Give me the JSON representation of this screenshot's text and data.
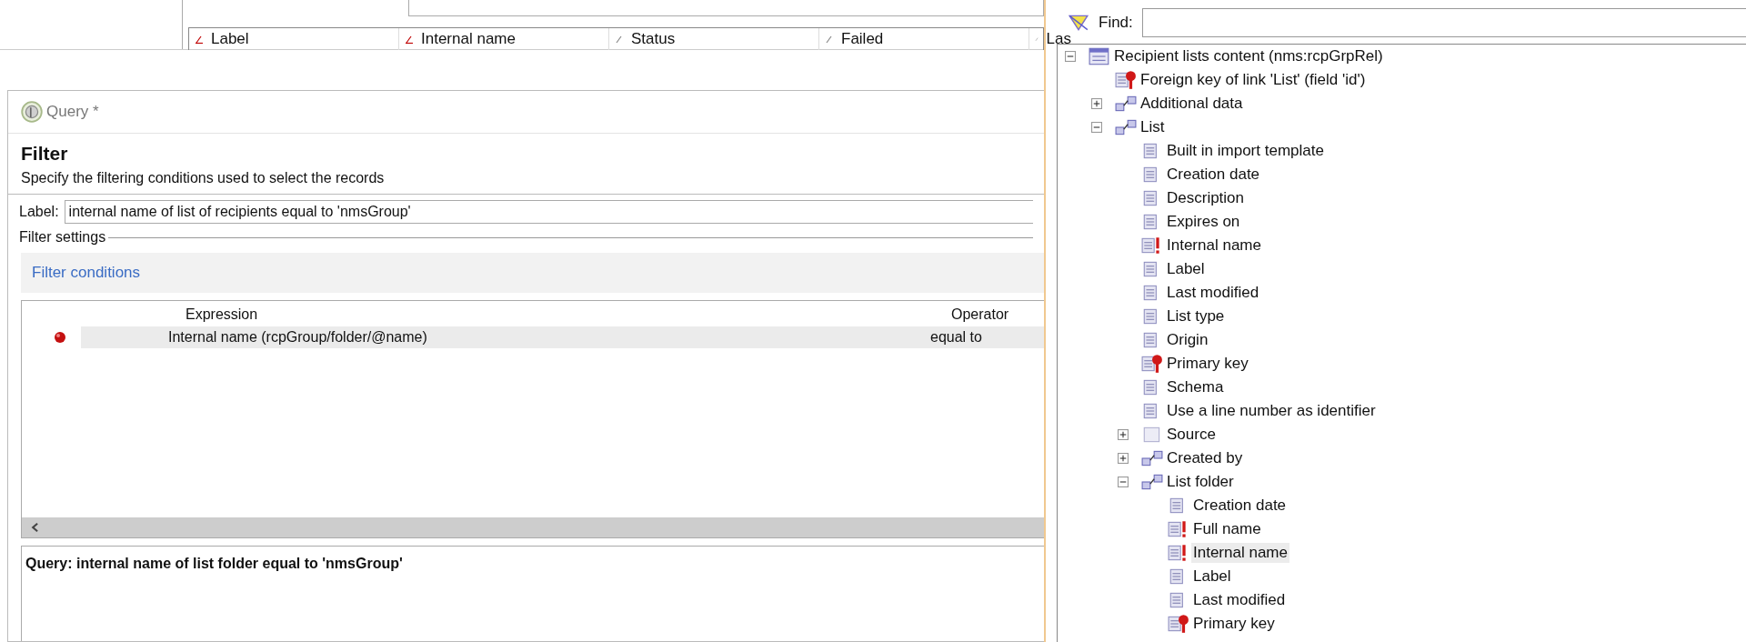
{
  "background_window": {
    "columns": [
      {
        "label": "Label",
        "sorted": true
      },
      {
        "label": "Internal name",
        "sorted": true
      },
      {
        "label": "Status",
        "sorted": false
      },
      {
        "label": "Failed",
        "sorted": false
      },
      {
        "label": "Las",
        "sorted": false
      }
    ]
  },
  "dialog": {
    "title": "Query *",
    "heading": "Filter",
    "description": "Specify the filtering conditions used to select the records",
    "label_caption": "Label:",
    "label_value": "internal name of list of recipients equal to 'nmsGroup'",
    "group_title": "Filter settings",
    "conditions_link": "Filter conditions",
    "table": {
      "columns": [
        "Expression",
        "Operator"
      ],
      "rows": [
        {
          "expression": "Internal name (rcpGroup/folder/@name)",
          "operator": "equal to",
          "selected": true
        }
      ]
    },
    "summary": "Query: internal name of list folder equal to 'nmsGroup'"
  },
  "schema_panel": {
    "find_label": "Find:",
    "tree": [
      {
        "label": "Recipient lists content (nms:rcpGrpRel)",
        "kind": "table",
        "expanded": true,
        "selected": false,
        "children": [
          {
            "label": "Foreign key of link 'List' (field 'id')",
            "kind": "key",
            "selected": false
          },
          {
            "label": "Additional data",
            "kind": "link",
            "expanded": false,
            "selected": false
          },
          {
            "label": "List",
            "kind": "link",
            "expanded": true,
            "selected": false,
            "children": [
              {
                "label": "Built in import template",
                "kind": "field",
                "selected": false
              },
              {
                "label": "Creation date",
                "kind": "field",
                "selected": false
              },
              {
                "label": "Description",
                "kind": "field",
                "selected": false
              },
              {
                "label": "Expires on",
                "kind": "field",
                "selected": false
              },
              {
                "label": "Internal name",
                "kind": "required",
                "selected": false
              },
              {
                "label": "Label",
                "kind": "field",
                "selected": false
              },
              {
                "label": "Last modified",
                "kind": "field",
                "selected": false
              },
              {
                "label": "List type",
                "kind": "field",
                "selected": false
              },
              {
                "label": "Origin",
                "kind": "field",
                "selected": false
              },
              {
                "label": "Primary key",
                "kind": "key",
                "selected": false
              },
              {
                "label": "Schema",
                "kind": "field",
                "selected": false
              },
              {
                "label": "Use a line number as identifier",
                "kind": "field",
                "selected": false
              },
              {
                "label": "Source",
                "kind": "element",
                "expanded": false,
                "selected": false
              },
              {
                "label": "Created by",
                "kind": "link",
                "expanded": false,
                "selected": false
              },
              {
                "label": "List folder",
                "kind": "link",
                "expanded": true,
                "selected": false,
                "children": [
                  {
                    "label": "Creation date",
                    "kind": "field",
                    "selected": false
                  },
                  {
                    "label": "Full name",
                    "kind": "required",
                    "selected": false
                  },
                  {
                    "label": "Internal name",
                    "kind": "required",
                    "selected": true
                  },
                  {
                    "label": "Label",
                    "kind": "field",
                    "selected": false
                  },
                  {
                    "label": "Last modified",
                    "kind": "field",
                    "selected": false
                  },
                  {
                    "label": "Primary key",
                    "kind": "key",
                    "selected": false
                  }
                ]
              }
            ]
          }
        ]
      }
    ]
  }
}
